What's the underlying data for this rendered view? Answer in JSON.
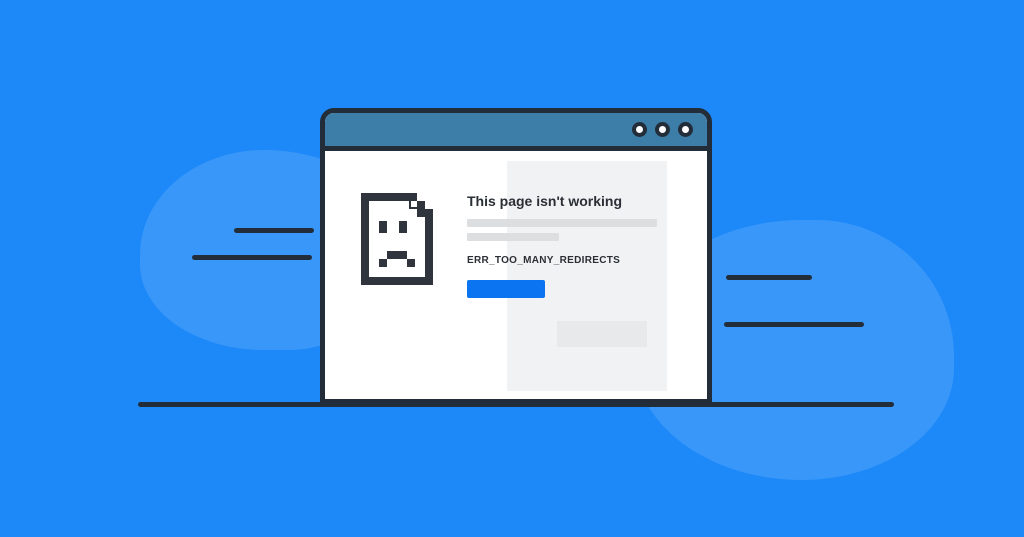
{
  "error": {
    "heading": "This page isn't working",
    "code": "ERR_TOO_MANY_REDIRECTS"
  },
  "colors": {
    "bg": "#1d89f8",
    "blob": "#3997f9",
    "stroke": "#232d3a",
    "titlebar": "#3c7ea8",
    "button": "#0b75f1",
    "placeholder": "#dcdedf"
  }
}
